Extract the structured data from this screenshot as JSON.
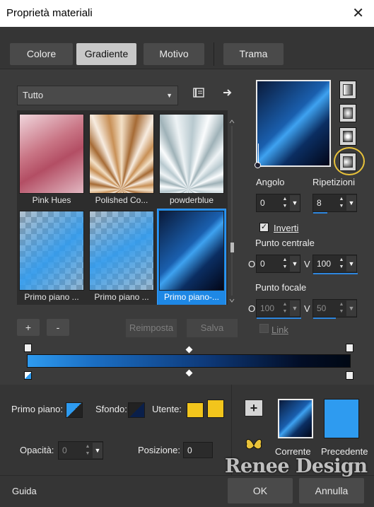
{
  "window": {
    "title": "Proprietà materiali",
    "close_glyph": "✕"
  },
  "tabs": [
    {
      "label": "Colore",
      "active": false
    },
    {
      "label": "Gradiente",
      "active": true
    },
    {
      "label": "Motivo",
      "active": false
    },
    {
      "label": "Trama",
      "active": false
    }
  ],
  "category_select": {
    "value": "Tutto"
  },
  "gallery": {
    "items": [
      {
        "label": "Pink Hues"
      },
      {
        "label": "Polished Co..."
      },
      {
        "label": "powderblue"
      },
      {
        "label": "Primo piano ..."
      },
      {
        "label": "Primo piano ..."
      },
      {
        "label": "Primo piano-...",
        "selected": true
      }
    ],
    "add_label": "+",
    "remove_label": "-",
    "reset_label": "Reimposta",
    "save_label": "Salva"
  },
  "gradient": {
    "angle_label": "Angolo",
    "angle_value": "0",
    "repeat_label": "Ripetizioni",
    "repeat_value": "8",
    "invert_label": "Inverti",
    "invert_checked": true,
    "center_label": "Punto centrale",
    "center_o_label": "O",
    "center_o_value": "0",
    "center_v_label": "V",
    "center_v_value": "100",
    "focal_label": "Punto focale",
    "focal_o_label": "O",
    "focal_o_value": "100",
    "focal_v_label": "V",
    "focal_v_value": "50",
    "link_label": "Link",
    "link_checked": false,
    "colors": {
      "start": "#2e9bf0",
      "end": "#000814"
    }
  },
  "materials": {
    "foreground_label": "Primo piano:",
    "background_label": "Sfondo:",
    "user_label": "Utente:",
    "opacity_label": "Opacità:",
    "opacity_value": "0",
    "position_label": "Posizione:",
    "position_value": "0",
    "user_color": "#f2c51c"
  },
  "compare": {
    "current_label": "Corrente",
    "previous_label": "Precedente",
    "previous_color": "#2e9bf0"
  },
  "footer": {
    "help_label": "Guida",
    "ok_label": "OK",
    "cancel_label": "Annulla"
  },
  "watermark": "Renee Design"
}
